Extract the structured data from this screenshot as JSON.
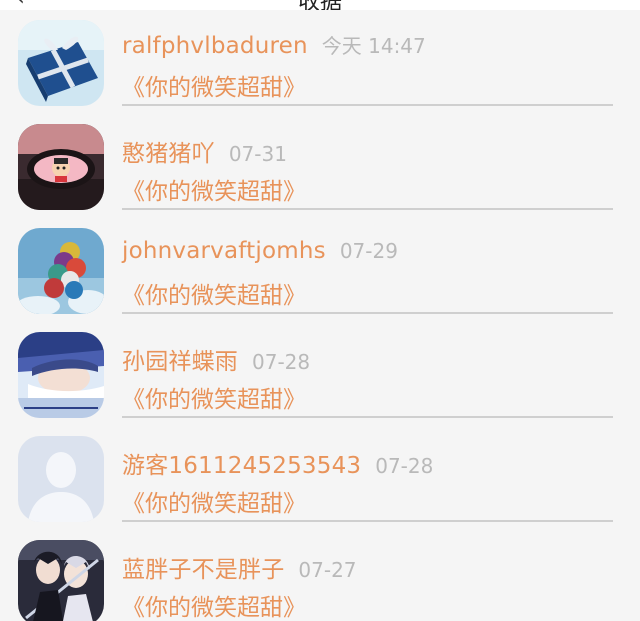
{
  "header": {
    "title": "收据",
    "back_icon": "back-arrow-icon"
  },
  "theme": {
    "accent": "#e8935a",
    "time_color": "#b9b9b9",
    "divider": "#cfcfcf",
    "background": "#f5f5f5"
  },
  "conversations": [
    {
      "name": "ralfphvlbaduren",
      "time": "今天 14:47",
      "message": "《你的微笑超甜》",
      "avatar": "gift-box-avatar"
    },
    {
      "name": "憨猪猪吖",
      "time": "07-31",
      "message": "《你的微笑超甜》",
      "avatar": "cartoon-mirror-avatar"
    },
    {
      "name": "johnvarvaftjomhs",
      "time": "07-29",
      "message": "《你的微笑超甜》",
      "avatar": "balloons-avatar"
    },
    {
      "name": "孙园祥蝶雨",
      "time": "07-28",
      "message": "《你的微笑超甜》",
      "avatar": "anime-boy-avatar"
    },
    {
      "name": "游客1611245253543",
      "time": "07-28",
      "message": "《你的微笑超甜》",
      "avatar": "default-user-avatar"
    },
    {
      "name": "蓝胖子不是胖子",
      "time": "07-27",
      "message": "《你的微笑超甜》",
      "avatar": "anime-couple-avatar"
    }
  ]
}
